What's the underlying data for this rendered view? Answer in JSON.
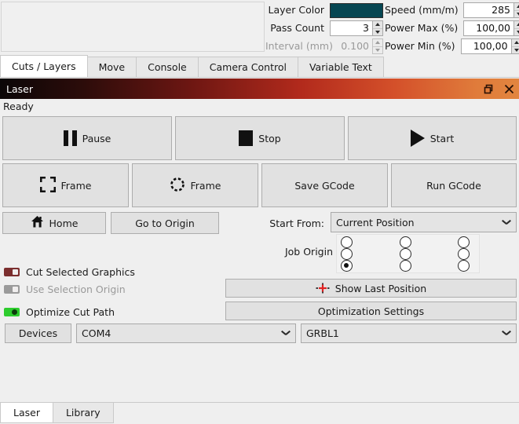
{
  "cut_settings": {
    "layer_color_label": "Layer Color",
    "layer_color_value": "#064652",
    "pass_count_label": "Pass Count",
    "pass_count_value": "3",
    "interval_label": "Interval (mm)",
    "interval_value": "0.100",
    "speed_label": "Speed (mm/m)",
    "speed_value": "285",
    "power_max_label": "Power Max (%)",
    "power_max_value": "100,00",
    "power_min_label": "Power Min (%)",
    "power_min_value": "100,00"
  },
  "tabs": [
    {
      "label": "Cuts / Layers",
      "active": true
    },
    {
      "label": "Move",
      "active": false
    },
    {
      "label": "Console",
      "active": false
    },
    {
      "label": "Camera Control",
      "active": false
    },
    {
      "label": "Variable Text",
      "active": false
    }
  ],
  "laser_panel": {
    "title": "Laser",
    "float_icon": "float-restore-icon",
    "close_icon": "close-icon",
    "status": "Ready",
    "titlebar_gradient_start": "#0b0607",
    "titlebar_gradient_end": "#e2853f"
  },
  "controls": {
    "pause": "Pause",
    "stop": "Stop",
    "start": "Start",
    "frame_square": "Frame",
    "frame_circle": "Frame",
    "save_gcode": "Save GCode",
    "run_gcode": "Run GCode",
    "home": "Home",
    "go_to_origin": "Go to Origin",
    "show_last_position": "Show Last Position",
    "optimization_settings": "Optimization Settings",
    "devices": "Devices"
  },
  "start_from": {
    "label": "Start From:",
    "value": "Current Position"
  },
  "job_origin": {
    "label": "Job Origin",
    "selected_row": 2,
    "selected_col": 0
  },
  "toggles": [
    {
      "label": "Cut Selected Graphics",
      "state": "on-red",
      "color": "#7b2e2e",
      "disabled": false
    },
    {
      "label": "Use Selection Origin",
      "state": "off",
      "color": "#9a9a9a",
      "disabled": true
    },
    {
      "label": "Optimize Cut Path",
      "state": "on",
      "color": "#2ecc2e",
      "disabled": false
    }
  ],
  "device_row": {
    "port": "COM4",
    "profile": "GRBL1"
  },
  "bottom_tabs": [
    {
      "label": "Laser",
      "active": true
    },
    {
      "label": "Library",
      "active": false
    }
  ]
}
